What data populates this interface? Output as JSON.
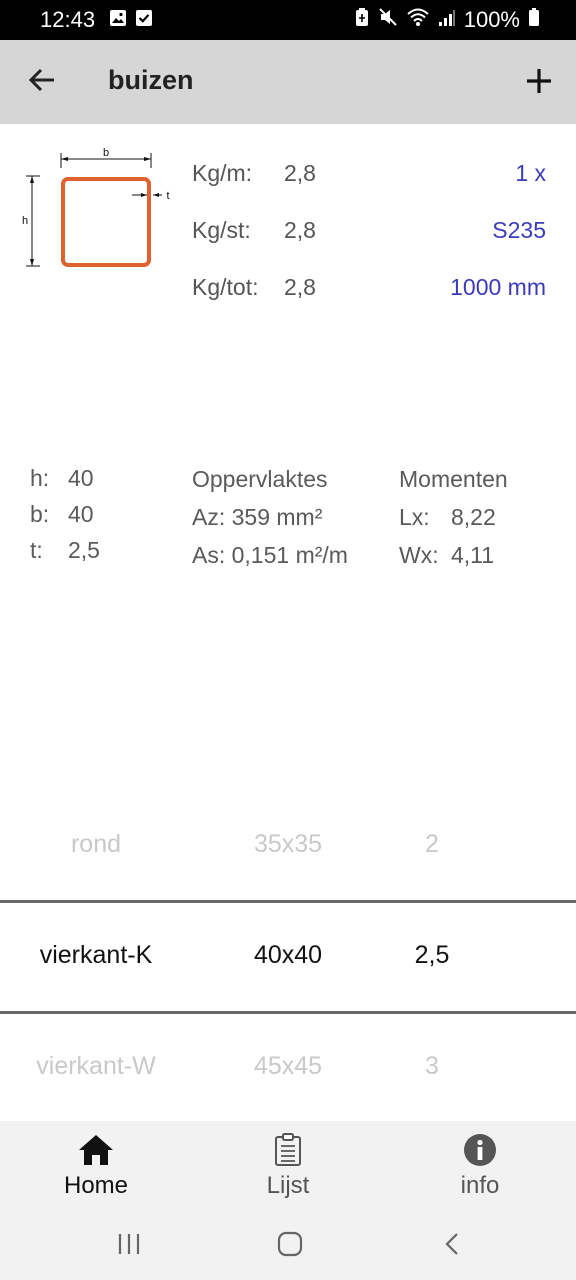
{
  "status_bar": {
    "time": "12:43",
    "battery": "100%"
  },
  "app_bar": {
    "title": "buizen"
  },
  "profile": {
    "diagram_labels": {
      "b": "b",
      "h": "h",
      "t": "t"
    },
    "accent_color": "#e0622e",
    "kg_rows": [
      {
        "label": "Kg/m:",
        "value": "2,8",
        "right": "1 x"
      },
      {
        "label": "Kg/st:",
        "value": "2,8",
        "right": "S235"
      },
      {
        "label": "Kg/tot:",
        "value": "2,8",
        "right": "1000 mm"
      }
    ]
  },
  "dimensions": {
    "h": {
      "label": "h:",
      "value": "40"
    },
    "b": {
      "label": "b:",
      "value": "40"
    },
    "t": {
      "label": "t:",
      "value": "2,5"
    }
  },
  "oppervlaktes": {
    "header": "Oppervlaktes",
    "az": {
      "label": "Az:",
      "value": "359 mm²"
    },
    "as": {
      "label": "As:",
      "value": "0,151 m²/m"
    }
  },
  "momenten": {
    "header": "Momenten",
    "lx": {
      "label": "Lx:",
      "value": "8,22"
    },
    "wx": {
      "label": "Wx:",
      "value": "4,11"
    }
  },
  "picker": {
    "rows": [
      {
        "type": "rond",
        "size": "35x35",
        "thickness": "2"
      },
      {
        "type": "vierkant-K",
        "size": "40x40",
        "thickness": "2,5"
      },
      {
        "type": "vierkant-W",
        "size": "45x45",
        "thickness": "3"
      }
    ]
  },
  "bottom_nav": {
    "home": "Home",
    "lijst": "Lijst",
    "info": "info"
  }
}
